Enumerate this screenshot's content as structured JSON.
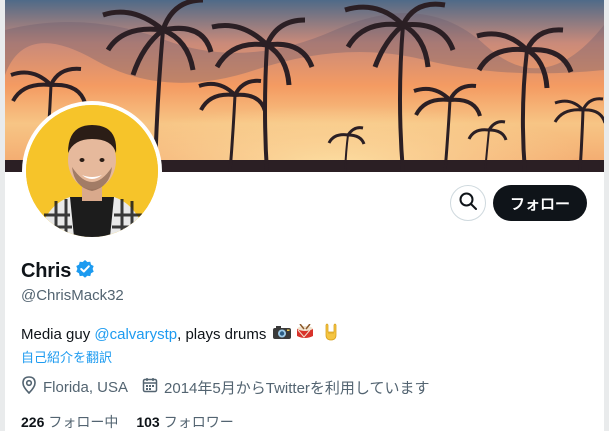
{
  "header": {
    "banner_image": "sunset-palm-trees",
    "colors": {
      "sky_top": "#4a6a8a",
      "sky_mid": "#f4a36c",
      "sky_glow": "#f7cf8a",
      "palm": "#2b1f24"
    }
  },
  "avatar": {
    "image": "profile-photo",
    "background": "#f6c42a"
  },
  "actions": {
    "search_icon": "search-icon",
    "follow_label": "フォロー"
  },
  "profile": {
    "display_name": "Chris",
    "verified_icon": "verified-badge-icon",
    "handle": "@ChrisMack32",
    "bio_prefix": "Media guy ",
    "bio_mention": "@calvarystp",
    "bio_suffix": ", plays drums",
    "bio_emojis": [
      "camera-icon",
      "drum-icon",
      "rock-hand-icon"
    ],
    "translate_label": "自己紹介を翻訳",
    "location": "Florida, USA",
    "location_icon": "location-pin-icon",
    "joined": "2014年5月からTwitterを利用しています",
    "joined_icon": "calendar-icon"
  },
  "stats": {
    "following_count": "226",
    "following_label": "フォロー中",
    "followers_count": "103",
    "followers_label": "フォロワー"
  }
}
